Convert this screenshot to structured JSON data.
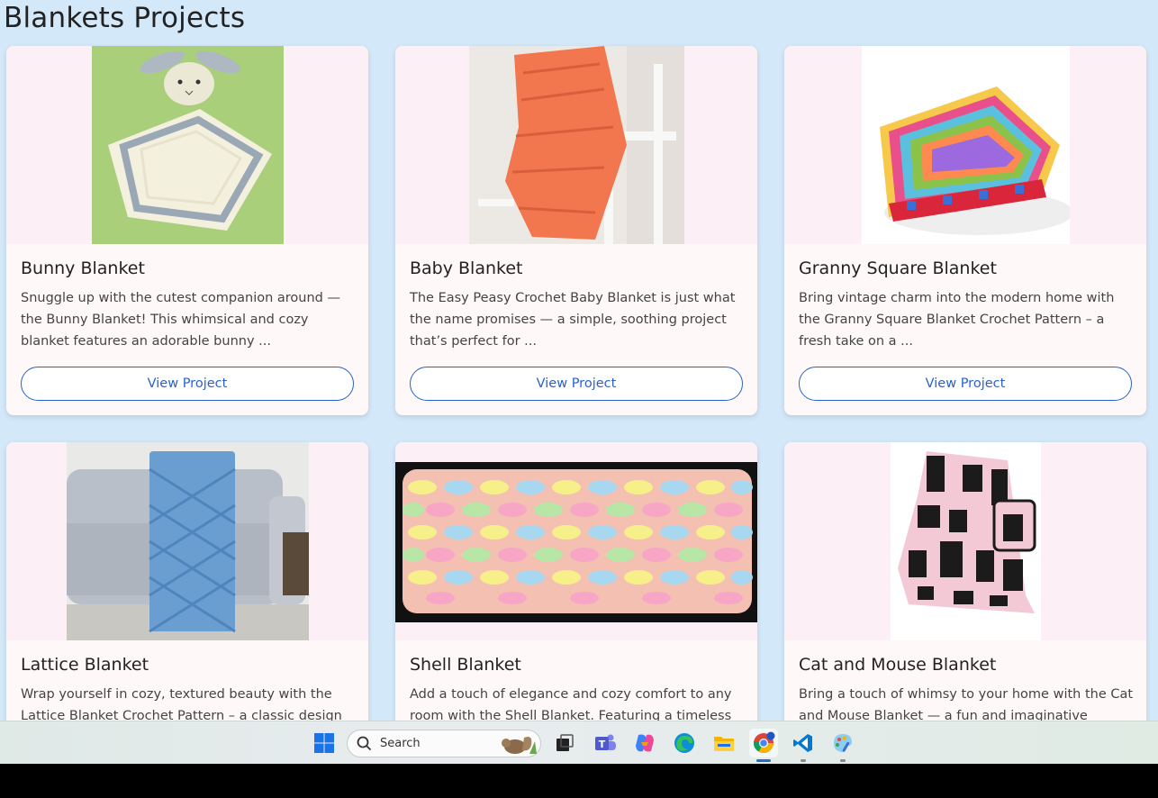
{
  "page": {
    "title": "Blankets Projects"
  },
  "projects": [
    {
      "title": "Bunny Blanket",
      "description": "Snuggle up with the cutest companion around — the Bunny Blanket! This whimsical and cozy blanket features an adorable bunny ...",
      "button": "View Project"
    },
    {
      "title": "Baby Blanket",
      "description": "The Easy Peasy Crochet Baby Blanket is just what the name promises — a simple, soothing project that’s perfect for ...",
      "button": "View Project"
    },
    {
      "title": "Granny Square Blanket",
      "description": "Bring vintage charm into the modern home with the Granny Square Blanket Crochet Pattern – a fresh take on a ...",
      "button": "View Project"
    },
    {
      "title": "Lattice Blanket",
      "description": "Wrap yourself in cozy, textured beauty with the Lattice Blanket Crochet Pattern – a classic design"
    },
    {
      "title": "Shell Blanket",
      "description": "Add a touch of elegance and cozy comfort to any room with the Shell Blanket. Featuring a timeless"
    },
    {
      "title": "Cat and Mouse Blanket",
      "description": "Bring a touch of whimsy to your home with the Cat and Mouse Blanket — a fun and imaginative"
    }
  ],
  "taskbar": {
    "search_label": "Search",
    "icons": [
      "windows-start-icon",
      "search-icon",
      "task-view-icon",
      "teams-icon",
      "copilot-icon",
      "edge-icon",
      "file-explorer-icon",
      "chrome-icon",
      "vscode-icon",
      "paint-icon"
    ],
    "accent": "#1f6fd1"
  },
  "colors": {
    "background": "#d3e8f8",
    "card": "#fff8f8",
    "button_border": "#2962c9"
  }
}
